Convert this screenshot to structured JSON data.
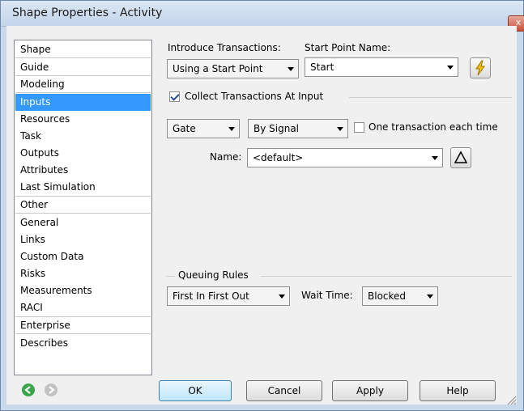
{
  "window": {
    "title": "Shape Properties - Activity",
    "close_glyph": "x"
  },
  "nav": {
    "sections": [
      {
        "header": "Shape",
        "items": [
          "Guide"
        ]
      },
      {
        "header": "Modeling",
        "items": [
          "Inputs",
          "Resources",
          "Task",
          "Outputs",
          "Attributes",
          "Last Simulation"
        ]
      },
      {
        "header": "Other",
        "items": [
          "General",
          "Links",
          "Custom Data",
          "Risks",
          "Measurements",
          "RACI"
        ]
      },
      {
        "header": "Enterprise",
        "items": [
          "Describes"
        ]
      }
    ],
    "selected": "Inputs",
    "back_icon": "back-arrow-icon",
    "forward_icon": "forward-arrow-icon"
  },
  "introduce": {
    "label": "Introduce Transactions:",
    "value": "Using a Start Point",
    "start_point_label": "Start Point Name:",
    "start_point_value": "Start",
    "lightning_icon": "lightning-icon"
  },
  "collect": {
    "label": "Collect Transactions At Input",
    "checked": true,
    "gate_value": "Gate",
    "signal_value": "By Signal",
    "one_each_label": "One transaction each time",
    "one_each_checked": false,
    "name_label": "Name:",
    "name_value": "<default>",
    "triangle_icon": "triangle-icon"
  },
  "queuing": {
    "label": "Queuing Rules",
    "rule_value": "First In First Out",
    "wait_label": "Wait Time:",
    "wait_value": "Blocked"
  },
  "buttons": {
    "ok": "OK",
    "cancel": "Cancel",
    "apply": "Apply",
    "help": "Help"
  },
  "colors": {
    "selection": "#3399ff",
    "title_bg": "#c9d9ec",
    "accent_icon": "#f5c400"
  }
}
